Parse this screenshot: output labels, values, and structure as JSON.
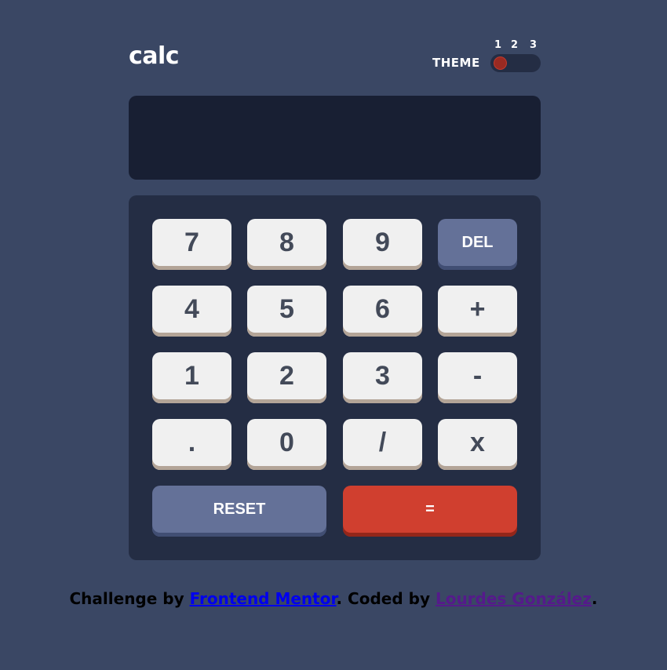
{
  "header": {
    "logo": "calc",
    "theme_label": "THEME",
    "theme_options": [
      "1",
      "2",
      "3"
    ],
    "theme_selected": 1
  },
  "display": {
    "value": ""
  },
  "keys": {
    "k7": "7",
    "k8": "8",
    "k9": "9",
    "del": "DEL",
    "k4": "4",
    "k5": "5",
    "k6": "6",
    "plus": "+",
    "k1": "1",
    "k2": "2",
    "k3": "3",
    "minus": "-",
    "dot": ".",
    "k0": "0",
    "divide": "/",
    "multiply": "x",
    "reset": "RESET",
    "equals": "="
  },
  "footer": {
    "prefix": "Challenge by ",
    "link1": "Frontend Mentor",
    "middle": ". Coded by ",
    "link2": "Lourdes González",
    "suffix": "."
  },
  "colors": {
    "background": "#3a4764",
    "keypad": "#242d44",
    "screen": "#181f33",
    "key": "#f0f0f0",
    "key_shadow": "#b3a497",
    "function_key": "#647198",
    "equals_key": "#d03f2f",
    "toggle_knob": "#9a2a22"
  }
}
